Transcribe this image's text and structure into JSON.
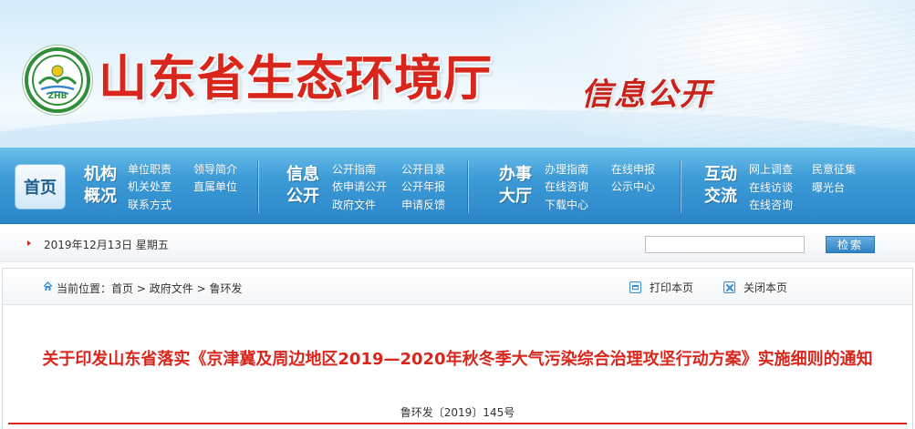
{
  "banner": {
    "site_title": "山东省生态环境厅",
    "subtitle": "信息公开",
    "logo_text": "ZHB"
  },
  "nav": {
    "home": "首页",
    "groups": [
      {
        "head": [
          "机构",
          "概况"
        ],
        "links": [
          "单位职责",
          "领导简介",
          "机关处室",
          "直属单位",
          "联系方式"
        ]
      },
      {
        "head": [
          "信息",
          "公开"
        ],
        "links": [
          "公开指南",
          "公开目录",
          "依申请公开",
          "公开年报",
          "政府文件",
          "申请反馈"
        ]
      },
      {
        "head": [
          "办事",
          "大厅"
        ],
        "links": [
          "办理指南",
          "在线申报",
          "在线咨询",
          "公示中心",
          "下载中心"
        ]
      },
      {
        "head": [
          "互动",
          "交流"
        ],
        "links": [
          "网上调查",
          "民意征集",
          "在线访谈",
          "曝光台",
          "在线咨询"
        ]
      }
    ]
  },
  "datebar": {
    "date": "2019年12月13日 星期五",
    "search_value": "",
    "search_button": "检索"
  },
  "breadcrumb": {
    "label": "当前位置：",
    "items": [
      "首页",
      "政府文件",
      "鲁环发"
    ],
    "separator": ">"
  },
  "tools": {
    "print": "打印本页",
    "close": "关闭本页"
  },
  "article": {
    "title": "关于印发山东省落实《京津冀及周边地区2019—2020年秋冬季大气污染综合治理攻坚行动方案》实施细则的通知",
    "doc_number": "鲁环发〔2019〕145号"
  },
  "colors": {
    "accent_red": "#d8261c",
    "nav_blue": "#2b86c8",
    "logo_green": "#2f8f3a"
  }
}
